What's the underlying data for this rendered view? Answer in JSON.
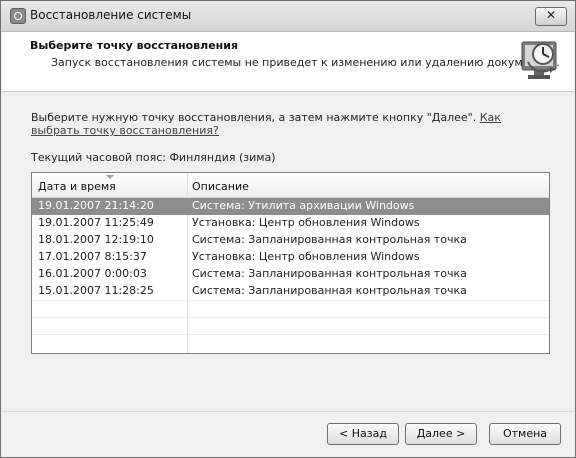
{
  "window": {
    "title": "Восстановление системы",
    "close_label": "✕"
  },
  "header": {
    "title": "Выберите точку восстановления",
    "description": "Запуск восстановления системы не приведет к изменению или удалению документов."
  },
  "main": {
    "instruction": "Выберите нужную точку восстановления, а затем нажмите кнопку \"Далее\".",
    "help_link": "Как выбрать точку восстановления?",
    "timezone": "Текущий часовой пояс: Финляндия (зима)"
  },
  "list": {
    "headers": [
      "Дата и время",
      "Описание"
    ],
    "rows": [
      {
        "date": "19.01.2007 21:14:20",
        "desc": "Система: Утилита архивации Windows"
      },
      {
        "date": "19.01.2007 11:25:49",
        "desc": "Установка: Центр обновления Windows"
      },
      {
        "date": "18.01.2007 12:19:10",
        "desc": "Система: Запланированная контрольная точка"
      },
      {
        "date": "17.01.2007 8:15:37",
        "desc": "Установка: Центр обновления Windows"
      },
      {
        "date": "16.01.2007 0:00:03",
        "desc": "Система: Запланированная контрольная точка"
      },
      {
        "date": "15.01.2007 11:28:25",
        "desc": "Система: Запланированная контрольная точка"
      }
    ],
    "selected_index": 0
  },
  "buttons": {
    "back": "< Назад",
    "next": "Далее >",
    "cancel": "Отмена"
  }
}
